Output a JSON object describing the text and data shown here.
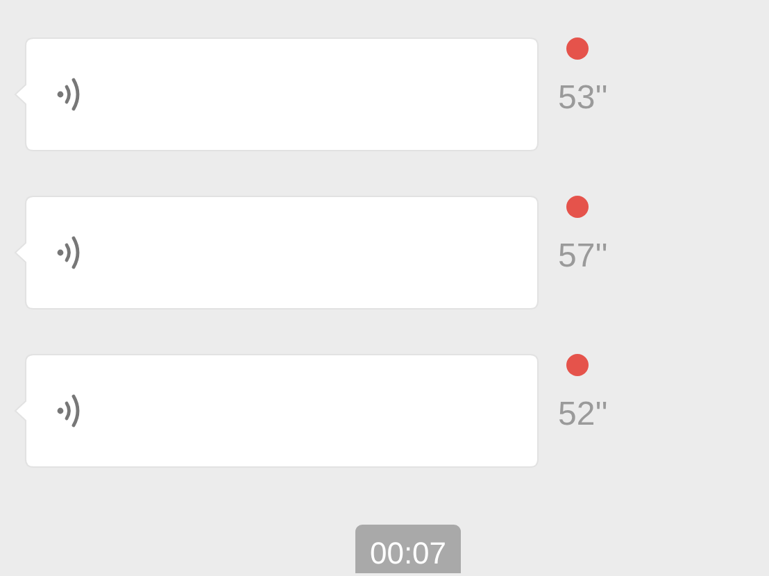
{
  "messages": [
    {
      "kind": "voice",
      "duration": "53''",
      "unread": true
    },
    {
      "kind": "voice",
      "duration": "57''",
      "unread": true
    },
    {
      "kind": "voice",
      "duration": "52''",
      "unread": true
    }
  ],
  "timestamp": "00:07"
}
